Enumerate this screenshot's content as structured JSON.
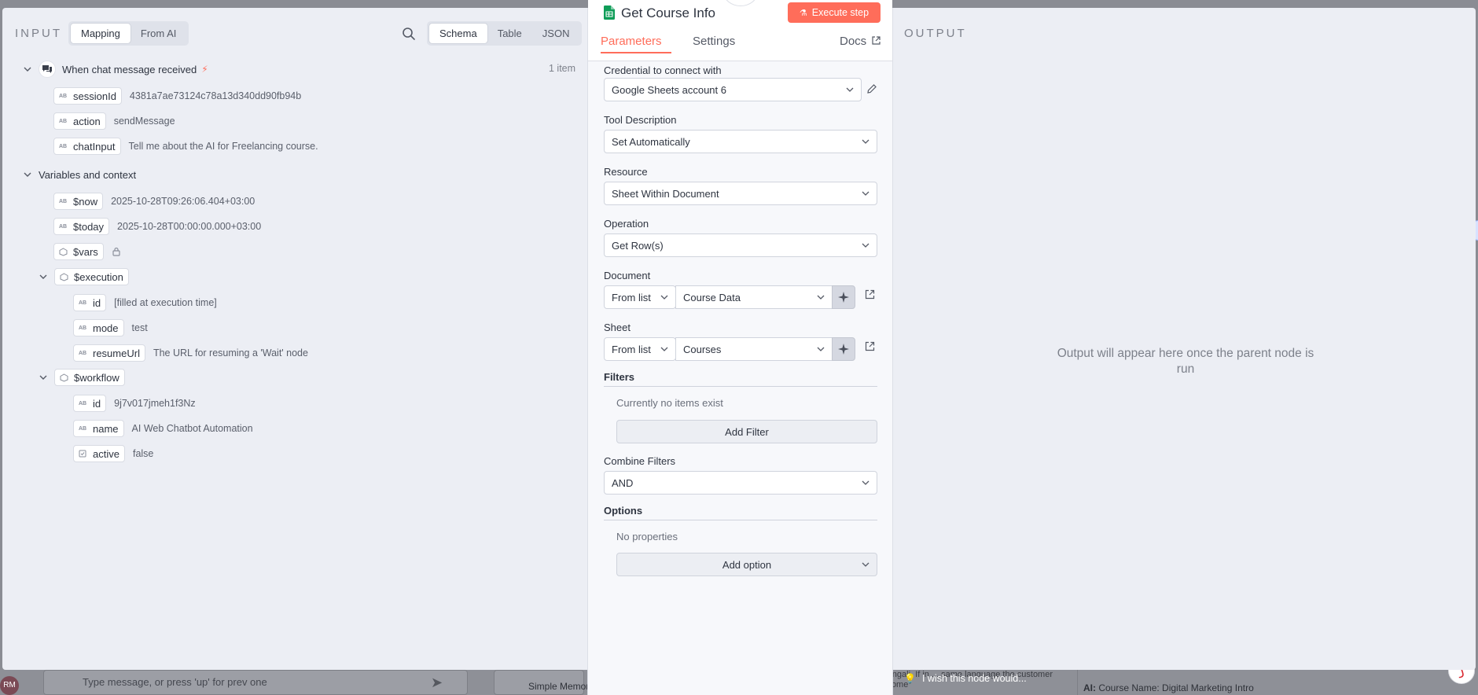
{
  "background": {
    "avatar_initials": "RM",
    "chat_placeholder": "Type message, or press 'up' for prev one",
    "memory_node_label": "Simple Memory",
    "node_prompt_snippet": "Bengali, reply in Bengali. If in ... same language the customer uses. The first welcome",
    "output_snippet_prefix": "AI:",
    "output_snippet_text": "Course Name: Digital Marketing Intro"
  },
  "input": {
    "label": "INPUT",
    "mode_tabs": [
      "Mapping",
      "From AI"
    ],
    "active_mode": "Mapping",
    "view_tabs": [
      "Schema",
      "Table",
      "JSON"
    ],
    "active_view": "Schema",
    "item_count": "1 item",
    "trigger": {
      "title": "When chat message received",
      "fields": [
        {
          "key": "sessionId",
          "value": "4381a7ae73124c78a13d340dd90fb94b"
        },
        {
          "key": "action",
          "value": "sendMessage"
        },
        {
          "key": "chatInput",
          "value": "Tell me about the AI for Freelancing course."
        }
      ]
    },
    "variables": {
      "title": "Variables and context",
      "now": {
        "key": "$now",
        "value": "2025-10-28T09:26:06.404+03:00"
      },
      "today": {
        "key": "$today",
        "value": "2025-10-28T00:00:00.000+03:00"
      },
      "vars": {
        "key": "$vars"
      },
      "execution": {
        "key": "$execution",
        "fields": [
          {
            "key": "id",
            "value": "[filled at execution time]"
          },
          {
            "key": "mode",
            "value": "test"
          },
          {
            "key": "resumeUrl",
            "value": "The URL for resuming a 'Wait' node"
          }
        ]
      },
      "workflow": {
        "key": "$workflow",
        "fields": [
          {
            "key": "id",
            "value": "9j7v017jmeh1f3Nz"
          },
          {
            "key": "name",
            "value": "AI Web Chatbot Automation"
          },
          {
            "key": "active",
            "value": "false"
          }
        ]
      }
    }
  },
  "node": {
    "title": "Get Course Info",
    "execute_label": "Execute step",
    "tabs": [
      "Parameters",
      "Settings"
    ],
    "active_tab": "Parameters",
    "docs_label": "Docs",
    "credential": {
      "label": "Credential to connect with",
      "value": "Google Sheets account 6"
    },
    "tool_description": {
      "label": "Tool Description",
      "value": "Set Automatically"
    },
    "resource": {
      "label": "Resource",
      "value": "Sheet Within Document"
    },
    "operation": {
      "label": "Operation",
      "value": "Get Row(s)"
    },
    "document": {
      "label": "Document",
      "mode": "From list",
      "value": "Course Data"
    },
    "sheet": {
      "label": "Sheet",
      "mode": "From list",
      "value": "Courses"
    },
    "filters": {
      "title": "Filters",
      "empty": "Currently no items exist",
      "add_label": "Add Filter"
    },
    "combine": {
      "label": "Combine Filters",
      "value": "AND"
    },
    "options": {
      "title": "Options",
      "empty": "No properties",
      "add_label": "Add option"
    },
    "tip": "I wish this node would..."
  },
  "output": {
    "label": "OUTPUT",
    "empty_message": "Output will appear here once the parent node is run"
  },
  "colors": {
    "accent": "#ff6d5a",
    "panel": "#eceef4"
  }
}
